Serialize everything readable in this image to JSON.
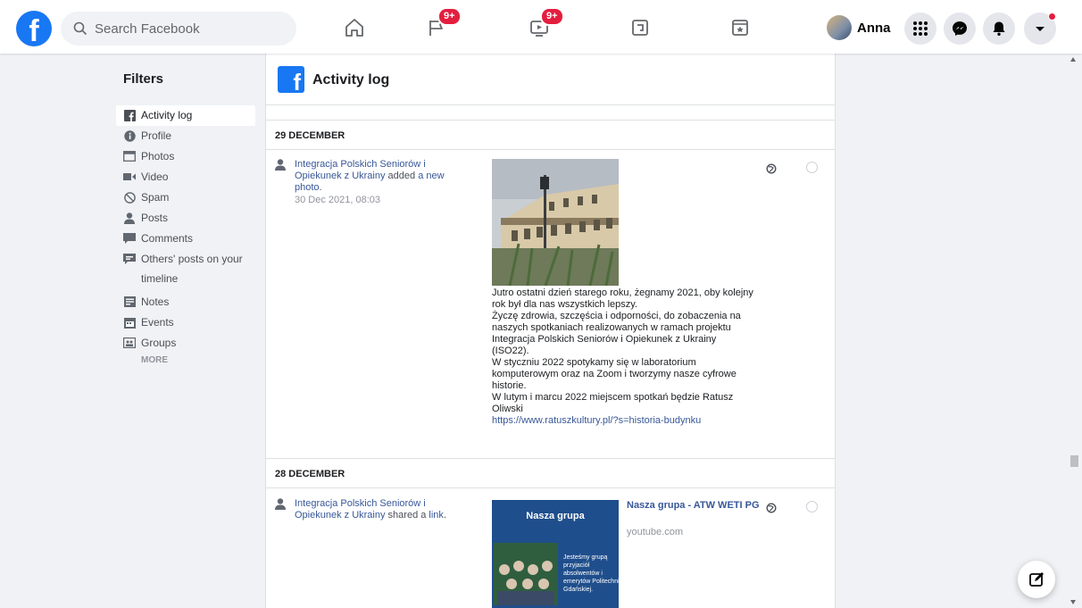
{
  "topbar": {
    "logo": "f",
    "search_placeholder": "Search Facebook",
    "badges": {
      "pages": "9+",
      "watch": "9+"
    },
    "profile_name": "Anna",
    "accent": "#1877f2"
  },
  "filters": {
    "title": "Filters",
    "items": [
      {
        "label": "Activity log",
        "icon": "facebook-icon"
      },
      {
        "label": "Profile",
        "icon": "info-icon"
      },
      {
        "label": "Photos",
        "icon": "photos-icon"
      },
      {
        "label": "Video",
        "icon": "video-icon"
      },
      {
        "label": "Spam",
        "icon": "spam-icon"
      },
      {
        "label": "Posts",
        "icon": "person-icon"
      },
      {
        "label": "Comments",
        "icon": "comment-icon"
      },
      {
        "label": "Others' posts on your timeline",
        "icon": "others-posts-icon"
      },
      {
        "label": "Notes",
        "icon": "notes-icon"
      },
      {
        "label": "Events",
        "icon": "events-icon"
      },
      {
        "label": "Groups",
        "icon": "groups-icon"
      }
    ],
    "more": "MORE"
  },
  "main": {
    "title": "Activity log",
    "sections": [
      {
        "date": "29 DECEMBER",
        "entry": {
          "actor": "Integracja Polskich Seniorów i Opiekunek z Ukrainy",
          "verb": " added ",
          "object": "a new photo",
          "period": ".",
          "timestamp": "30 Dec 2021, 08:03",
          "text_lines": [
            "Jutro ostatni dzień starego roku, żegnamy 2021, oby kolejny rok był dla nas wszystkich lepszy.",
            "Życzę zdrowia, szczęścia i odporności, do zobaczenia na naszych spotkaniach realizowanych w ramach projektu Integracja Polskich Seniorów i Opiekunek z Ukrainy (ISO22).",
            "W styczniu 2022 spotykamy się w laboratorium komputerowym oraz na Zoom i tworzymy nasze cyfrowe historie.",
            "W lutym i marcu 2022 miejscem spotkań będzie Ratusz Oliwski"
          ],
          "url": "https://www.ratuszkultury.pl/?s=historia-budynku"
        }
      },
      {
        "date": "28 DECEMBER",
        "entry": {
          "actor": "Integracja Polskich Seniorów i Opiekunek z Ukrainy",
          "verb": " shared a ",
          "object": "link",
          "period": ".",
          "thumb_title": "Nasza grupa",
          "thumb_body": "Jesteśmy grupą przyjaciół absolwentów i emerytów Politechniki Gdańskiej.",
          "link_title": "Nasza grupa - ATW WETI PG",
          "link_domain": "youtube.com"
        }
      }
    ]
  }
}
